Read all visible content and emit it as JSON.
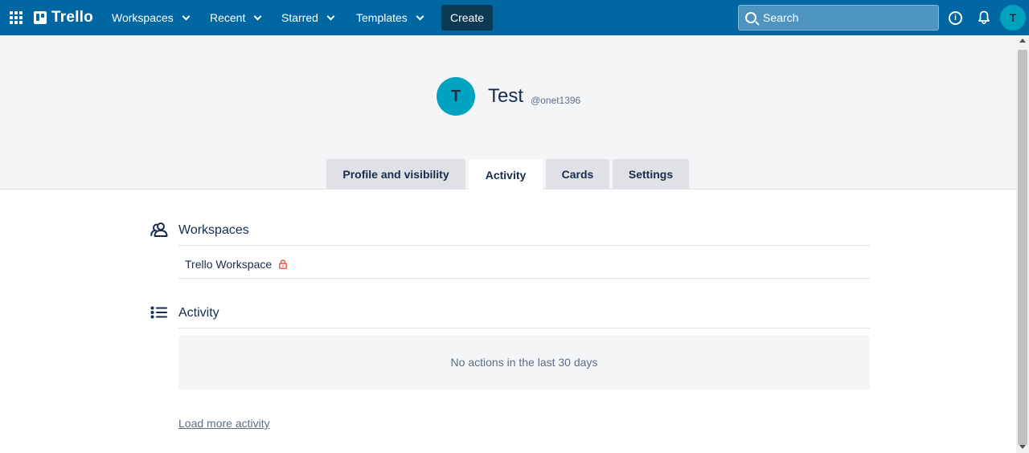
{
  "nav": {
    "logo": "Trello",
    "items": [
      "Workspaces",
      "Recent",
      "Starred",
      "Templates"
    ],
    "create_label": "Create",
    "search_placeholder": "Search",
    "avatar_initial": "T",
    "info_icon": "info-icon",
    "bell_icon": "bell-icon"
  },
  "profile": {
    "avatar_initial": "T",
    "name": "Test",
    "username": "@onet1396"
  },
  "tabs": [
    {
      "label": "Profile and visibility",
      "active": false
    },
    {
      "label": "Activity",
      "active": true
    },
    {
      "label": "Cards",
      "active": false
    },
    {
      "label": "Settings",
      "active": false
    }
  ],
  "workspaces_section": {
    "title": "Workspaces",
    "items": [
      {
        "label": "Trello Workspace",
        "private": true
      }
    ]
  },
  "activity_section": {
    "title": "Activity",
    "empty_message": "No actions in the last 30 days",
    "load_more": "Load more activity"
  },
  "colors": {
    "topbar": "#0067a3",
    "avatar": "#00a3bf",
    "lock": "#eb5a46"
  }
}
